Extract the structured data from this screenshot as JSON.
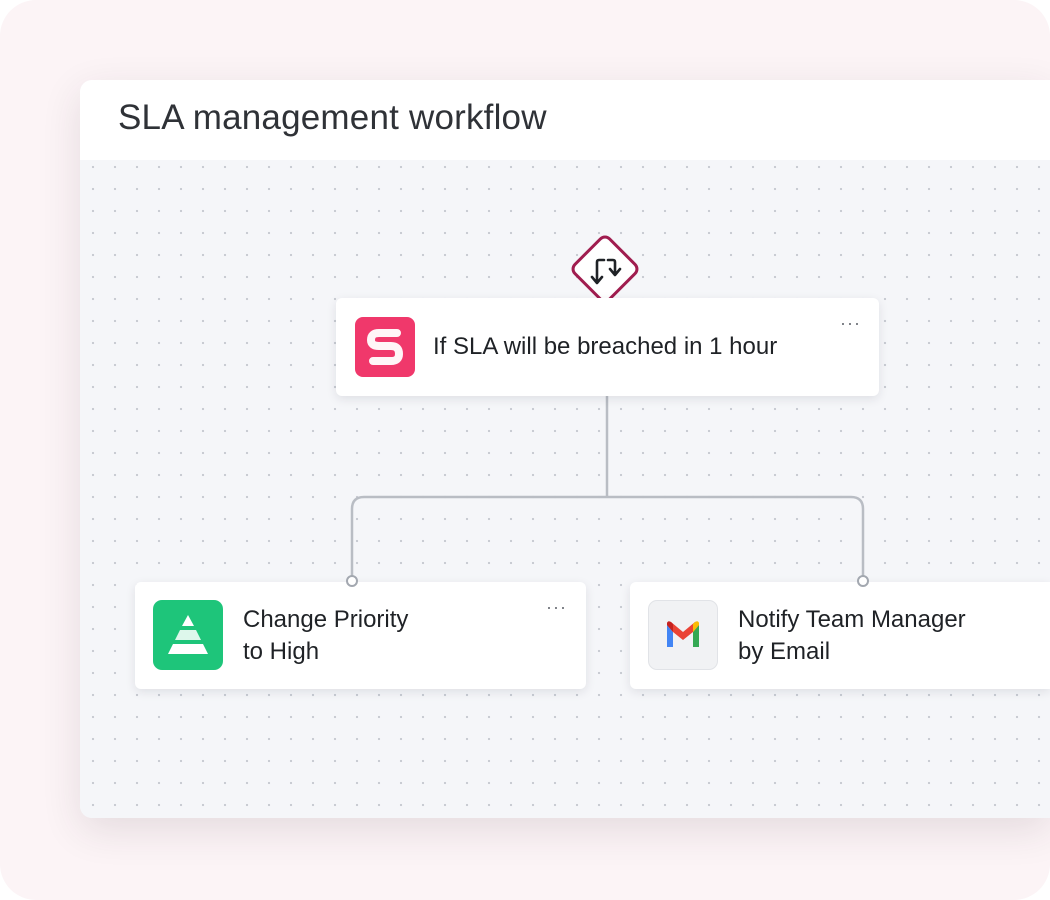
{
  "window": {
    "title": "SLA management workflow"
  },
  "workflow": {
    "trigger": {
      "icon": "branch-arrows-icon",
      "accent_color": "#a01d4f"
    },
    "condition_node": {
      "label": "If SLA will be breached in 1 hour",
      "icon": "sla-app-icon",
      "icon_color": "#f0386b",
      "more_label": "···"
    },
    "actions": [
      {
        "label_line1": "Change Priority",
        "label_line2": "to High",
        "icon": "priority-pyramid-icon",
        "icon_color": "#1ec57a",
        "more_label": "···"
      },
      {
        "label_line1": "Notify Team Manager",
        "label_line2": "by Email",
        "icon": "gmail-icon"
      }
    ]
  }
}
